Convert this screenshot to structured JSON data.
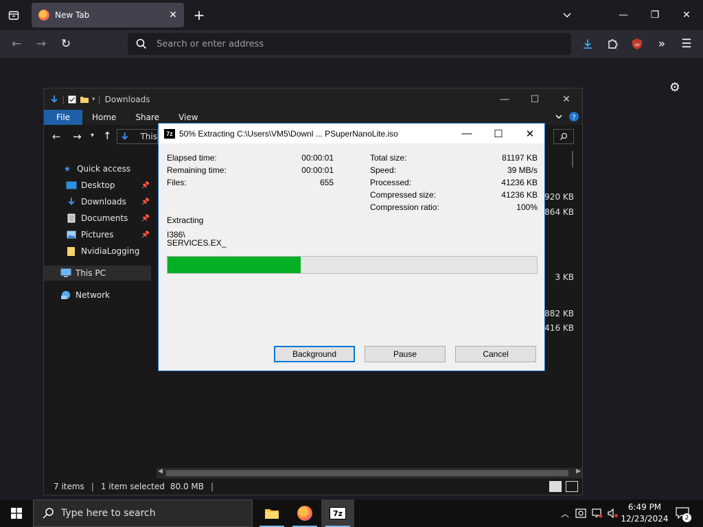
{
  "browser": {
    "tab_title": "New Tab",
    "tab_close": "✕",
    "new_tab": "+",
    "url_placeholder": "Search or enter address",
    "minimize": "—",
    "maximize": "❐",
    "close": "✕"
  },
  "explorer": {
    "title": "Downloads",
    "ribbon_tabs": [
      "File",
      "Home",
      "Share",
      "View"
    ],
    "breadcrumb_partial": "This",
    "nav": {
      "quick_access": "Quick access",
      "desktop": "Desktop",
      "downloads": "Downloads",
      "documents": "Documents",
      "pictures": "Pictures",
      "nvidia": "NvidiaLogging",
      "this_pc": "This PC",
      "network": "Network"
    },
    "sizes": [
      ",920 KB",
      ",864 KB",
      "3 KB",
      ",882 KB",
      "416 KB"
    ],
    "status": {
      "items": "7 items",
      "selected": "1 item selected",
      "size": "80.0 MB"
    }
  },
  "sevenzip": {
    "title": "50% Extracting C:\\Users\\VM5\\Downl ... PSuperNanoLite.iso",
    "logo": "7z",
    "progress_percent": 50,
    "left_stats": [
      {
        "label": "Elapsed time:",
        "value": "00:00:01"
      },
      {
        "label": "Remaining time:",
        "value": "00:00:01"
      },
      {
        "label": "Files:",
        "value": "655"
      }
    ],
    "right_stats": [
      {
        "label": "Total size:",
        "value": "81197 KB"
      },
      {
        "label": "Speed:",
        "value": "39 MB/s"
      },
      {
        "label": "Processed:",
        "value": "41236 KB"
      },
      {
        "label": "Compressed size:",
        "value": "41236 KB"
      },
      {
        "label": "Compression ratio:",
        "value": "100%"
      }
    ],
    "extracting_label": "Extracting",
    "current_path": "I386\\",
    "current_file": "SERVICES.EX_",
    "buttons": {
      "background": "Background",
      "pause": "Pause",
      "cancel": "Cancel"
    }
  },
  "taskbar": {
    "search_placeholder": "Type here to search",
    "time": "6:49 PM",
    "date": "12/23/2024",
    "notifications": "2"
  },
  "colors": {
    "progress_fill": "#06b025",
    "file_tab": "#1f5fa8",
    "ff_bg": "#1c1b22"
  }
}
